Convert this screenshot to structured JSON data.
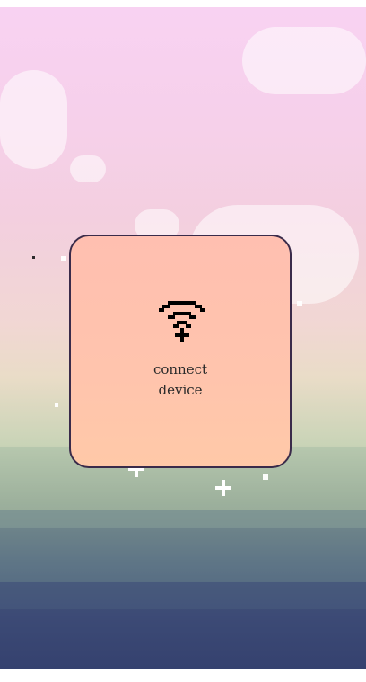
{
  "card": {
    "label_line1": "connect",
    "label_line2": "device",
    "icon": "wifi-connect-icon"
  },
  "colors": {
    "card_fill": "#ffc4ad",
    "card_border": "#3a2b4a",
    "sky_top": "#f8d2f2",
    "ground_bottom": "#2f3866"
  }
}
